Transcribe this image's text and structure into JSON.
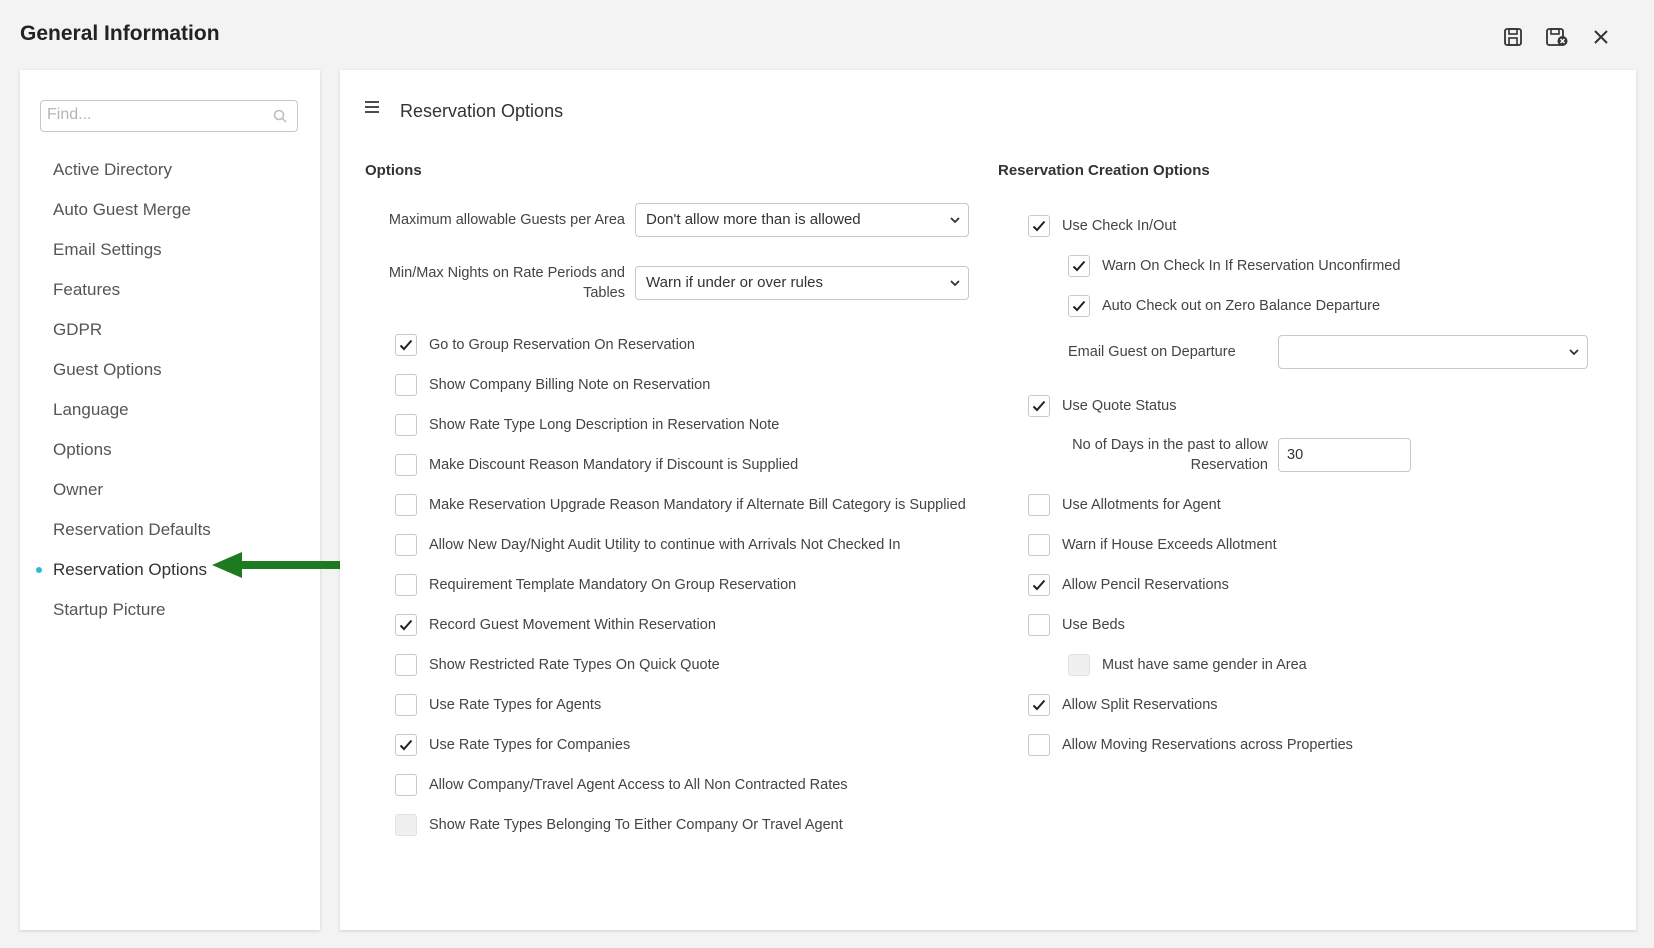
{
  "window": {
    "title": "General Information",
    "icons": [
      "save-icon",
      "save-close-icon",
      "close-icon"
    ]
  },
  "sidebar": {
    "search_placeholder": "Find...",
    "items": [
      {
        "label": "Active Directory"
      },
      {
        "label": "Auto Guest Merge"
      },
      {
        "label": "Email Settings"
      },
      {
        "label": "Features"
      },
      {
        "label": "GDPR"
      },
      {
        "label": "Guest Options"
      },
      {
        "label": "Language"
      },
      {
        "label": "Options"
      },
      {
        "label": "Owner"
      },
      {
        "label": "Reservation Defaults"
      },
      {
        "label": "Reservation Options",
        "active": true
      },
      {
        "label": "Startup Picture"
      }
    ]
  },
  "page": {
    "title": "Reservation Options"
  },
  "options": {
    "heading": "Options",
    "max_guests": {
      "label": "Maximum allowable Guests per Area",
      "value": "Don't allow more than is allowed"
    },
    "min_max_nights": {
      "label": "Min/Max Nights on Rate Periods and Tables",
      "value": "Warn if under or over rules"
    },
    "checkboxes": [
      {
        "label": "Go to Group Reservation On Reservation",
        "checked": true
      },
      {
        "label": "Show Company Billing Note on Reservation",
        "checked": false
      },
      {
        "label": "Show Rate Type Long Description in Reservation Note",
        "checked": false
      },
      {
        "label": "Make Discount Reason Mandatory if Discount is Supplied",
        "checked": false
      },
      {
        "label": "Make Reservation Upgrade Reason Mandatory if Alternate Bill Category is Supplied",
        "checked": false
      },
      {
        "label": "Allow New Day/Night Audit Utility to continue with Arrivals Not Checked In",
        "checked": false
      },
      {
        "label": "Requirement Template Mandatory On Group Reservation",
        "checked": false
      },
      {
        "label": "Record Guest Movement Within Reservation",
        "checked": true
      },
      {
        "label": "Show Restricted Rate Types On Quick Quote",
        "checked": false
      },
      {
        "label": "Use Rate Types for Agents",
        "checked": false
      },
      {
        "label": "Use Rate Types for Companies",
        "checked": true
      },
      {
        "label": "Allow Company/Travel Agent Access to All Non Contracted Rates",
        "checked": false
      },
      {
        "label": "Show Rate Types Belonging To Either Company Or Travel Agent",
        "checked": false,
        "disabled": true
      }
    ]
  },
  "creation": {
    "heading": "Reservation Creation Options",
    "use_check_in_out": {
      "label": "Use Check In/Out",
      "checked": true
    },
    "warn_unconfirmed": {
      "label": "Warn On Check In If Reservation Unconfirmed",
      "checked": true
    },
    "auto_check_out": {
      "label": "Auto Check out on Zero Balance Departure",
      "checked": true
    },
    "email_guest": {
      "label": "Email Guest on Departure",
      "value": ""
    },
    "use_quote_status": {
      "label": "Use Quote Status",
      "checked": true
    },
    "days_past": {
      "label": "No of Days in the past to allow Reservation",
      "value": "30"
    },
    "use_allotments": {
      "label": "Use Allotments for Agent",
      "checked": false
    },
    "warn_house": {
      "label": "Warn if House Exceeds Allotment",
      "checked": false
    },
    "allow_pencil": {
      "label": "Allow Pencil Reservations",
      "checked": true
    },
    "use_beds": {
      "label": "Use Beds",
      "checked": false
    },
    "same_gender": {
      "label": "Must have same gender in Area",
      "checked": false,
      "disabled": true
    },
    "allow_split": {
      "label": "Allow Split Reservations",
      "checked": true
    },
    "allow_moving": {
      "label": "Allow Moving Reservations across Properties",
      "checked": false
    }
  },
  "colors": {
    "accent_dot": "#2bbcd1",
    "arrow": "#1e7a1e"
  }
}
